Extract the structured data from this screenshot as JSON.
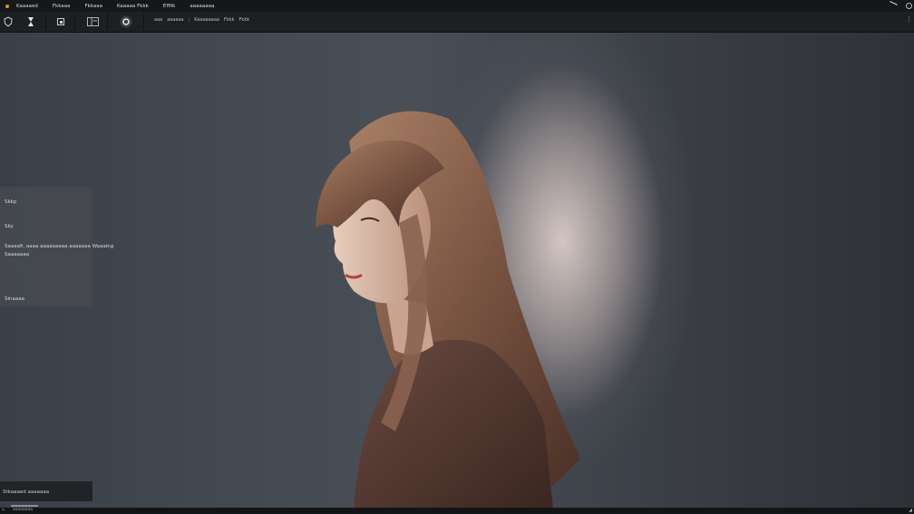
{
  "menubar": {
    "items": [
      "Kaaaaed",
      "Fkkaaa",
      "Fkkaaa",
      "Kaaaaa Fkkk",
      "Effilk",
      "aaaaaaaa"
    ]
  },
  "toolbar": {
    "breadcrumbs": [
      "aaa",
      "aaaaaa",
      "Kaaaaaaaa",
      "Fkkk",
      "Fkkk"
    ]
  },
  "panel": {
    "title": "Skkp",
    "label": "Sky",
    "desc_line1": "Saaaafi, aaaa aaaaaaaaa aaaaaaa Waaaing",
    "desc_line2": "Saaaaaaa",
    "footer": "Sinaaaa"
  },
  "bottom_panel": {
    "label": "Stkaaaed aaaaaaa"
  },
  "statusbar": {
    "text": "aaaaaaaa"
  },
  "colors": {
    "accent": "#e0922a",
    "chrome_dark": "#151719",
    "toolbar": "#1d2023"
  }
}
